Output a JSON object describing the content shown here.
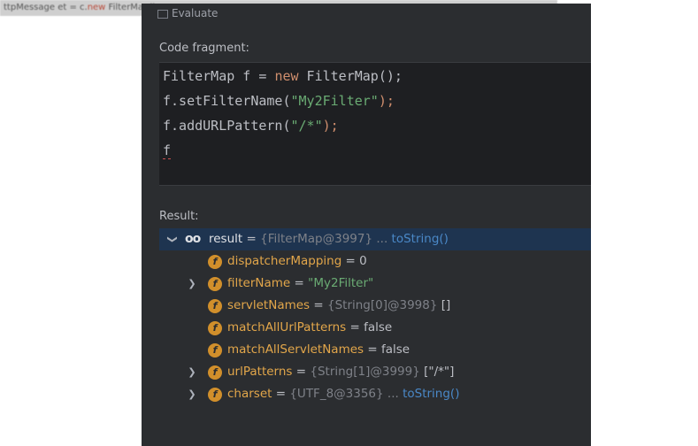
{
  "top_bar": {
    "text_a": "ttpMessage et = c.",
    "text_red": "new",
    "text_b": " FilterMap();"
  },
  "window_title": "Evaluate",
  "code": {
    "label": "Code fragment:",
    "lines": [
      [
        {
          "t": "FilterMap f = ",
          "c": "pl"
        },
        {
          "t": "new",
          "c": "kw"
        },
        {
          "t": " FilterMap();",
          "c": "pl"
        }
      ],
      [
        {
          "t": "f.setFilterName(",
          "c": "pl"
        },
        {
          "t": "\"My2Filter\"",
          "c": "str"
        },
        {
          "t": ");",
          "c": "kw"
        }
      ],
      [
        {
          "t": "f.addURLPattern(",
          "c": "pl"
        },
        {
          "t": "\"/*\"",
          "c": "str"
        },
        {
          "t": ");",
          "c": "kw"
        }
      ],
      [
        {
          "t": "f",
          "c": "err"
        }
      ]
    ]
  },
  "result": {
    "label": "Result:",
    "root": {
      "name": "result",
      "eq": " = ",
      "ref": "{FilterMap@3997}",
      "dots": " ... ",
      "link": "toString()"
    },
    "fields": [
      {
        "expand": false,
        "icon": "f",
        "name": "dispatcherMapping",
        "eq": " = ",
        "ref": "",
        "val": "0",
        "valtype": "val",
        "link": ""
      },
      {
        "expand": true,
        "icon": "f",
        "name": "filterName",
        "eq": " = ",
        "ref": "",
        "val": "\"My2Filter\"",
        "valtype": "valstr",
        "link": ""
      },
      {
        "expand": false,
        "icon": "f",
        "name": "servletNames",
        "eq": " = ",
        "ref": "{String[0]@3998} ",
        "val": "[]",
        "valtype": "val",
        "link": ""
      },
      {
        "expand": false,
        "icon": "f",
        "name": "matchAllUrlPatterns",
        "eq": " = ",
        "ref": "",
        "val": "false",
        "valtype": "val",
        "link": ""
      },
      {
        "expand": false,
        "icon": "f",
        "name": "matchAllServletNames",
        "eq": " = ",
        "ref": "",
        "val": "false",
        "valtype": "val",
        "link": ""
      },
      {
        "expand": true,
        "icon": "f",
        "name": "urlPatterns",
        "eq": " = ",
        "ref": "{String[1]@3999} ",
        "val": "[\"/*\"]",
        "valtype": "val",
        "link": ""
      },
      {
        "expand": true,
        "icon": "f",
        "name": "charset",
        "eq": " = ",
        "ref": "{UTF_8@3356}",
        "val": " ... ",
        "valtype": "ref",
        "link": "toString()"
      }
    ]
  },
  "icons": {
    "expand": "chevron-right-icon",
    "collapse": "chevron-down-icon",
    "watch": "glasses-icon",
    "field": "field-icon"
  }
}
